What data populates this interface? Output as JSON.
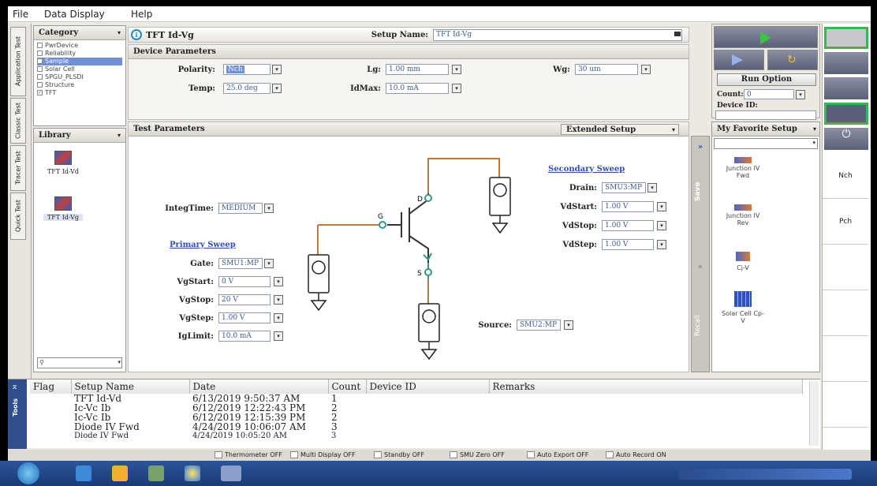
{
  "menu": [
    "File",
    "Data Display",
    "Help"
  ],
  "vertical_tabs": [
    "Application Test",
    "Classic Test",
    "Tracer Test",
    "Quick Test"
  ],
  "category": {
    "title": "Category",
    "items": [
      "PwrDevice",
      "Reliability",
      "Sample",
      "Solar Cell",
      "SPGU_PLSDI",
      "Structure",
      "TFT"
    ]
  },
  "library": {
    "title": "Library",
    "items": [
      "TFT Id-Vd",
      "TFT Id-Vg"
    ]
  },
  "setup": {
    "title": "TFT Id-Vg",
    "name_label": "Setup Name:",
    "name_value": "TFT Id-Vg"
  },
  "device_params": {
    "title": "Device Parameters",
    "polarity_label": "Polarity:",
    "polarity_value": "Nch",
    "lg_label": "Lg:",
    "lg_value": "1.00 mm",
    "wg_label": "Wg:",
    "wg_value": "30 um",
    "temp_label": "Temp:",
    "temp_value": "25.0 deg",
    "idmax_label": "IdMax:",
    "idmax_value": "10.0 mA"
  },
  "test_params": {
    "title": "Test Parameters",
    "extended_setup": "Extended Setup",
    "integ_label": "IntegTime:",
    "integ_value": "MEDIUM",
    "primary_sweep": "Primary Sweep",
    "gate_label": "Gate:",
    "gate_value": "SMU1:MP",
    "vgstart_label": "VgStart:",
    "vgstart_value": "0 V",
    "vgstop_label": "VgStop:",
    "vgstop_value": "20 V",
    "vgstep_label": "VgStep:",
    "vgstep_value": "1.00 V",
    "iglimit_label": "IgLimit:",
    "iglimit_value": "10.0 mA",
    "secondary_sweep": "Secondary Sweep",
    "drain_label": "Drain:",
    "drain_value": "SMU3:MP",
    "vdstart_label": "VdStart:",
    "vdstart_value": "1.00 V",
    "vdstop_label": "VdStop:",
    "vdstop_value": "1.00 V",
    "vdstep_label": "VdStep:",
    "vdstep_value": "1.00 V",
    "source_label": "Source:",
    "source_value": "SMU2:MP",
    "node_d": "D",
    "node_g": "G",
    "node_s": "S"
  },
  "side_tabs": {
    "save": "Save",
    "recall": "Recall"
  },
  "run": {
    "run_option": "Run Option",
    "count_label": "Count:",
    "count_value": "0",
    "device_id_label": "Device ID:",
    "favorite_label": "My Favorite Setup"
  },
  "favorites": [
    {
      "label": "Junction IV Fwd"
    },
    {
      "label": "Junction IV Rev"
    },
    {
      "label": "Cj-V"
    },
    {
      "label": "Solar Cell Cp-V"
    }
  ],
  "right_tabs": [
    "Nch",
    "Pch"
  ],
  "results": {
    "tools_label": "Tools",
    "columns": [
      "Flag",
      "Setup Name",
      "Date",
      "Count",
      "Device ID",
      "Remarks"
    ],
    "rows": [
      {
        "setup": "TFT Id-Vd",
        "date": "6/13/2019 9:50:37 AM",
        "count": "1"
      },
      {
        "setup": "Ic-Vc Ib",
        "date": "6/12/2019 12:22:43 PM",
        "count": "2"
      },
      {
        "setup": "Ic-Vc Ib",
        "date": "6/12/2019 12:15:39 PM",
        "count": "2"
      },
      {
        "setup": "Diode IV Fwd",
        "date": "4/24/2019 10:06:07 AM",
        "count": "3"
      },
      {
        "setup": "Diode IV Fwd",
        "date": "4/24/2019 10:05:20 AM",
        "count": "3"
      }
    ]
  },
  "status": [
    "Thermometer OFF",
    "Multi Display OFF",
    "Standby OFF",
    "SMU Zero OFF",
    "Auto Export OFF",
    "Auto Record ON"
  ],
  "colors": {
    "accent": "#2e50b8",
    "wire": "#c8743a",
    "wire_green": "#2f9a86",
    "selected": "#6f8fd8"
  }
}
